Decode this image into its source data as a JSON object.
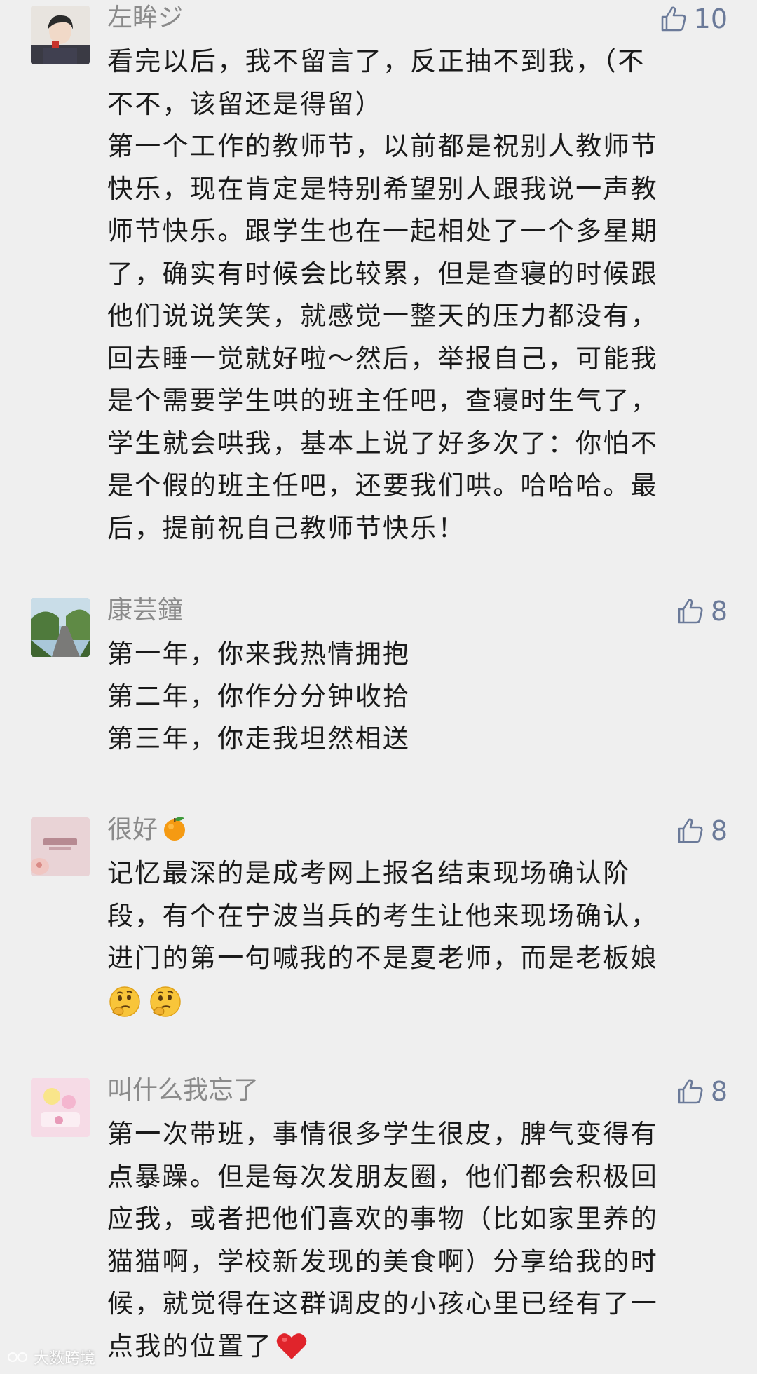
{
  "comments": [
    {
      "nickname": "左眸ジ",
      "likes": "10",
      "lines": [
        "看完以后，我不留言了，反正抽不到我，（不",
        "不不，该留还是得留）",
        "第一个工作的教师节，以前都是祝别人教师节",
        "快乐，现在肯定是特别希望别人跟我说一声教",
        "师节快乐。跟学生也在一起相处了一个多星期",
        "了，确实有时候会比较累，但是查寝的时候跟",
        "他们说说笑笑，就感觉一整天的压力都没有，",
        "回去睡一觉就好啦～然后，举报自己，可能我",
        "是个需要学生哄的班主任吧，查寝时生气了，",
        "学生就会哄我，基本上说了好多次了：你怕不",
        "是个假的班主任吧，还要我们哄。哈哈哈。最",
        "后，提前祝自己教师节快乐！"
      ]
    },
    {
      "nickname": "康芸鐘",
      "likes": "8",
      "lines": [
        "第一年，你来我热情拥抱",
        "第二年，你作分分钟收拾",
        "第三年，你走我坦然相送"
      ]
    },
    {
      "nickname": "很好",
      "nickname_emoji": "tangerine-emoji",
      "likes": "8",
      "lines": [
        "记忆最深的是成考网上报名结束现场确认阶",
        "段，有个在宁波当兵的考生让他来现场确认，",
        "进门的第一句喊我的不是夏老师，而是老板娘"
      ],
      "trailing_emojis": [
        "thinking-face-emoji",
        "thinking-face-emoji"
      ]
    },
    {
      "nickname": "叫什么我忘了",
      "likes": "8",
      "lines": [
        "第一次带班，事情很多学生很皮，脾气变得有",
        "点暴躁。但是每次发朋友圈，他们都会积极回",
        "应我，或者把他们喜欢的事物（比如家里养的",
        "猫猫啊，学校新发现的美食啊）分享给我的时",
        "候，就觉得在这群调皮的小孩心里已经有了一",
        "点我的位置了"
      ],
      "last_line_emoji": "red-heart-emoji"
    }
  ],
  "watermark": "大数跨境",
  "colors": {
    "background": "#efefef",
    "nickname": "#8a8a8a",
    "text": "#1a1a1a",
    "like": "#6b7a99"
  }
}
